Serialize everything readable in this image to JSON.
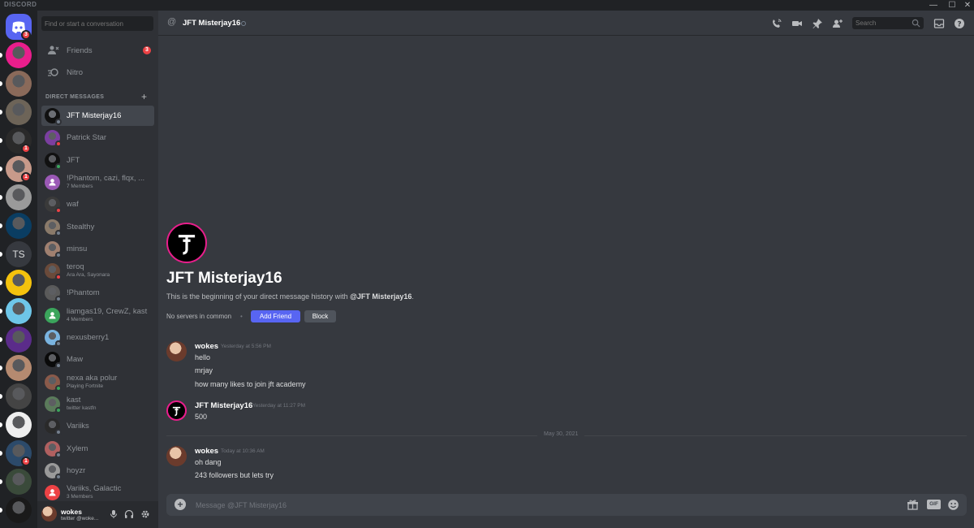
{
  "app": {
    "brand": "DISCORD",
    "minimize": "—",
    "maximize": "☐",
    "close": "✕"
  },
  "servers": [
    {
      "kind": "home",
      "badge": "3",
      "color": "#5865f2"
    },
    {
      "badge": "",
      "color": "#e91e8c"
    },
    {
      "badge": "",
      "color": "#8a6a5a"
    },
    {
      "badge": "",
      "color": "#6d6458"
    },
    {
      "badge": "1",
      "color": "#2a2a2a"
    },
    {
      "badge": "1",
      "color": "#c79a8a"
    },
    {
      "badge": "",
      "color": "#9a9a9a"
    },
    {
      "badge": "",
      "color": "#0a3d62"
    },
    {
      "text": "TS",
      "badge": ""
    },
    {
      "badge": "",
      "color": "#f4c20d"
    },
    {
      "badge": "",
      "color": "#6ec6e8"
    },
    {
      "badge": "",
      "color": "#5b2c8a"
    },
    {
      "badge": "",
      "color": "#b58a70"
    },
    {
      "badge": "",
      "color": "#444"
    },
    {
      "badge": "",
      "color": "#eeeeee"
    },
    {
      "badge": "1",
      "color": "#2c4a6a"
    },
    {
      "badge": "",
      "color": "#3a4a3a"
    },
    {
      "badge": "",
      "color": "#1a1a1a"
    }
  ],
  "sidebar": {
    "search_placeholder": "Find or start a conversation",
    "friends": {
      "label": "Friends",
      "badge": "3"
    },
    "nitro": {
      "label": "Nitro"
    },
    "dm_header": "DIRECT MESSAGES",
    "dms": [
      {
        "name": "JFT Misterjay16",
        "sub": "",
        "status": "offline",
        "avatar": "#111111",
        "active": true
      },
      {
        "name": "Patrick Star",
        "sub": "",
        "status": "dnd",
        "avatar": "#7b3fa0"
      },
      {
        "name": "JFT",
        "sub": "",
        "status": "online",
        "avatar": "#111111"
      },
      {
        "name": "!Phantom, cazi, flqx, ...",
        "sub": "7 Members",
        "status": "",
        "avatar": "#9b59b6",
        "group": true
      },
      {
        "name": "waf",
        "sub": "",
        "status": "dnd",
        "avatar": "#3a3a3a"
      },
      {
        "name": "Stealthy",
        "sub": "",
        "status": "offline",
        "avatar": "#8a7a6a"
      },
      {
        "name": "minsu",
        "sub": "",
        "status": "offline",
        "avatar": "#a08070"
      },
      {
        "name": "teroq",
        "sub": "Ara Ara, Sayonara",
        "status": "dnd",
        "avatar": "#6a4a3a"
      },
      {
        "name": "!Phantom",
        "sub": "",
        "status": "offline",
        "avatar": "#5a5a5a"
      },
      {
        "name": "liamgas19, CrewZ, kast",
        "sub": "4 Members",
        "status": "",
        "avatar": "#3ba55c",
        "group": true
      },
      {
        "name": "nexusberry1",
        "sub": "",
        "status": "offline",
        "avatar": "#7ab4e0"
      },
      {
        "name": "Maw",
        "sub": "",
        "status": "offline",
        "avatar": "#0a0a0a"
      },
      {
        "name": "nexa aka polur",
        "sub": "Playing Fortnite",
        "status": "online",
        "avatar": "#8a5a4a"
      },
      {
        "name": "kast",
        "sub": "twitter kastfn",
        "status": "online",
        "avatar": "#5a7a5a"
      },
      {
        "name": "Variiks",
        "sub": "",
        "status": "offline",
        "avatar": "#2a2a2a"
      },
      {
        "name": "Xylem",
        "sub": "",
        "status": "offline",
        "avatar": "#b06060"
      },
      {
        "name": "hoyzr",
        "sub": "",
        "status": "offline",
        "avatar": "#9a9a9a"
      },
      {
        "name": "Variiks, Galactic",
        "sub": "3 Members",
        "status": "",
        "avatar": "#ed4245",
        "group": true
      }
    ]
  },
  "user": {
    "name": "wokes",
    "sub": "twitter @woke..."
  },
  "header": {
    "at": "@",
    "name": "JFT Misterjay16",
    "search_placeholder": "Search"
  },
  "welcome": {
    "title": "JFT Misterjay16",
    "desc_prefix": "This is the beginning of your direct message history with ",
    "desc_handle": "@JFT Misterjay16",
    "desc_suffix": ".",
    "no_servers": "No servers in common",
    "sep": "•",
    "add_friend": "Add Friend",
    "block": "Block"
  },
  "messages": [
    {
      "author": "wokes",
      "time": "Yesterday at 5:56 PM",
      "lines": [
        "hello",
        "mrjay",
        "how many likes to join jft academy"
      ]
    },
    {
      "author": "JFT Misterjay16",
      "time": "Yesterday at 11:27 PM",
      "lines": [
        "500"
      ]
    },
    {
      "author": "wokes",
      "time": "Today at 10:36 AM",
      "lines": [
        "oh dang",
        "243 followers but lets try"
      ]
    }
  ],
  "divider": "May 30, 2021",
  "composer": {
    "placeholder": "Message @JFT Misterjay16",
    "gif": "GIF"
  }
}
